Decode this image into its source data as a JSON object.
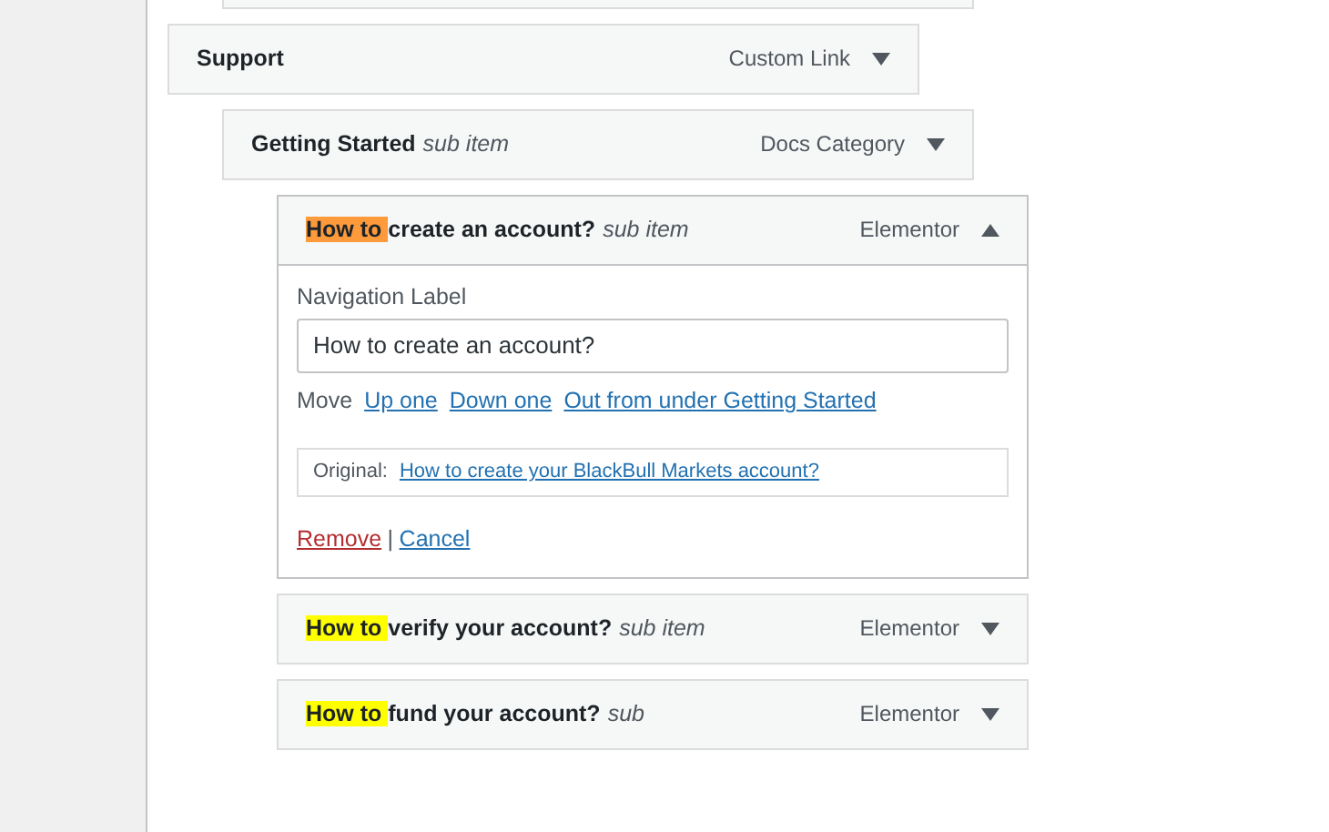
{
  "menu_items": [
    {
      "title": "Support",
      "type": "Custom Link",
      "expanded": false,
      "children": [
        {
          "title": "Getting Started",
          "subtitle": "sub item",
          "type": "Docs Category",
          "expanded": false,
          "children": [
            {
              "highlight": {
                "text": "How to ",
                "color": "#fd9a3c"
              },
              "title": "create an account?",
              "subtitle": "sub item",
              "type": "Elementor",
              "expanded": true,
              "settings": {
                "label": "Navigation Label",
                "value": "How to create an account?",
                "move_label": "Move",
                "move_links": [
                  "Up one",
                  "Down one",
                  "Out from under Getting Started"
                ],
                "original_label": "Original:",
                "original_link": "How to create your BlackBull Markets account?",
                "remove": "Remove",
                "separator": "|",
                "cancel": "Cancel"
              }
            },
            {
              "highlight": {
                "text": "How to ",
                "color": "#ffff00"
              },
              "title": "verify your account?",
              "subtitle": "sub item",
              "type": "Elementor",
              "expanded": false
            },
            {
              "highlight": {
                "text": "How to ",
                "color": "#ffff00"
              },
              "title": "fund your account?",
              "subtitle": "sub",
              "type": "Elementor",
              "expanded": false
            }
          ]
        }
      ]
    }
  ]
}
